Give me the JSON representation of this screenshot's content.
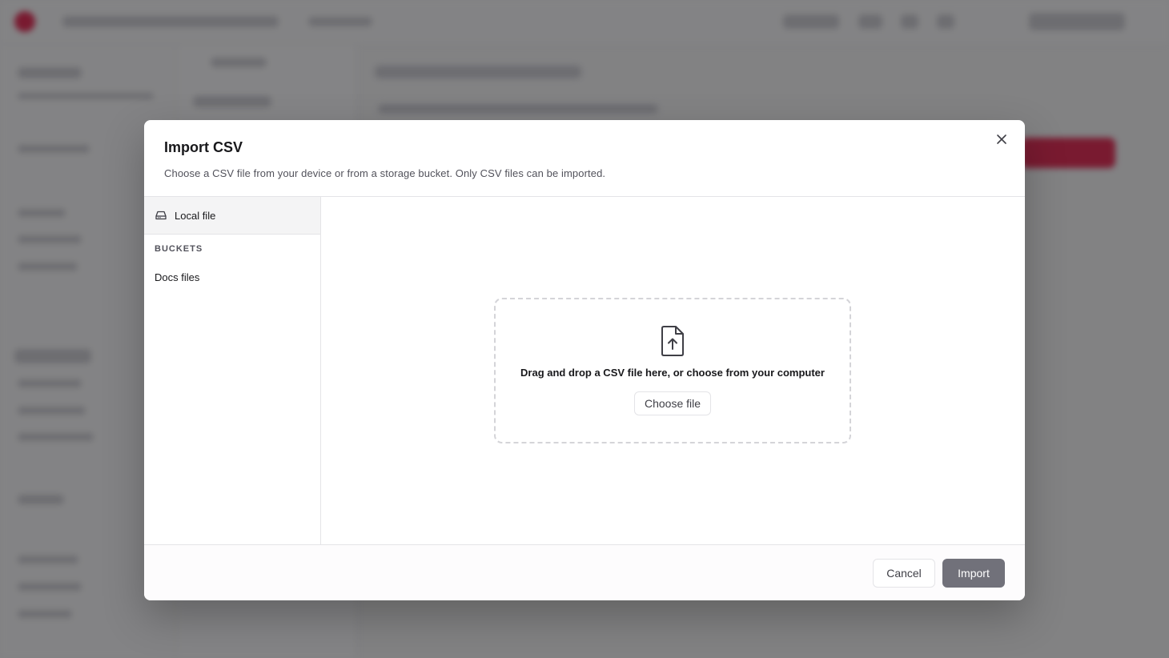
{
  "dialog": {
    "title": "Import CSV",
    "description": "Choose a CSV file from your device or from a storage bucket. Only CSV files can be imported.",
    "close_icon": "close-icon"
  },
  "sources": {
    "local_file": {
      "label": "Local file",
      "icon": "hard-drive-icon"
    },
    "buckets_heading": "BUCKETS",
    "buckets": [
      {
        "label": "Docs files"
      }
    ]
  },
  "dropzone": {
    "icon": "file-upload-icon",
    "text": "Drag and drop a CSV file here, or choose from your computer",
    "choose_label": "Choose file"
  },
  "footer": {
    "cancel_label": "Cancel",
    "import_label": "Import"
  },
  "colors": {
    "overlay": "#18181b",
    "import_button": "#71717a",
    "brand_accent": "#e11d48"
  }
}
